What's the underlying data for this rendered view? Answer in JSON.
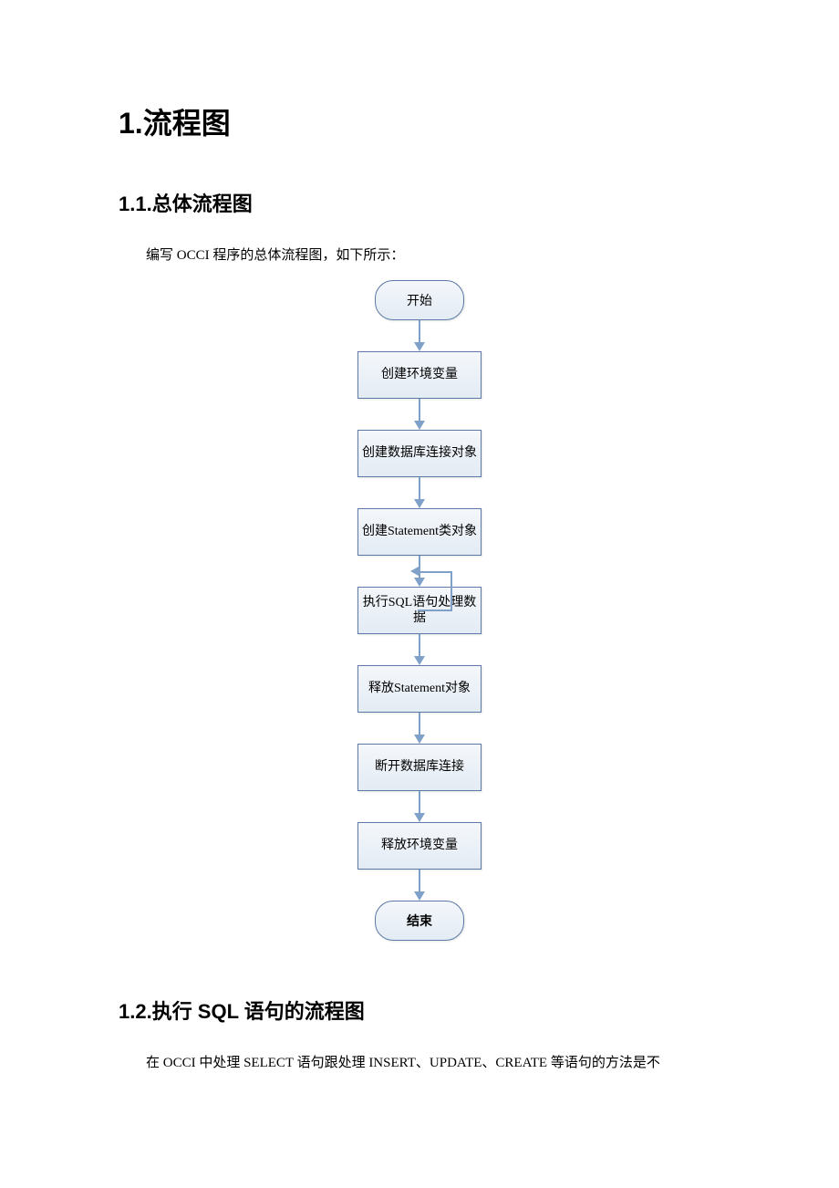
{
  "headings": {
    "h1": "1.流程图",
    "h1_1": "1.1.总体流程图",
    "h1_2": "1.2.执行 SQL 语句的流程图"
  },
  "paragraphs": {
    "intro1": "编写 OCCI 程序的总体流程图，如下所示：",
    "intro2": "在 OCCI 中处理 SELECT 语句跟处理 INSERT、UPDATE、CREATE 等语句的方法是不"
  },
  "flow": {
    "start": "开始",
    "n1": "创建环境变量",
    "n2": "创建数据库连接对象",
    "n3": "创建Statement类对象",
    "n4": "执行SQL语句处理数据",
    "n5": "释放Statement对象",
    "n6": "断开数据库连接",
    "n7": "释放环境变量",
    "end": "结束"
  },
  "chart_data": {
    "type": "flowchart",
    "title": "编写 OCCI 程序的总体流程图",
    "nodes": [
      {
        "id": "start",
        "shape": "terminator",
        "label": "开始"
      },
      {
        "id": "n1",
        "shape": "process",
        "label": "创建环境变量"
      },
      {
        "id": "n2",
        "shape": "process",
        "label": "创建数据库连接对象"
      },
      {
        "id": "n3",
        "shape": "process",
        "label": "创建Statement类对象"
      },
      {
        "id": "n4",
        "shape": "process",
        "label": "执行SQL语句处理数据"
      },
      {
        "id": "n5",
        "shape": "process",
        "label": "释放Statement对象"
      },
      {
        "id": "n6",
        "shape": "process",
        "label": "断开数据库连接"
      },
      {
        "id": "n7",
        "shape": "process",
        "label": "释放环境变量"
      },
      {
        "id": "end",
        "shape": "terminator",
        "label": "结束"
      }
    ],
    "edges": [
      {
        "from": "start",
        "to": "n1"
      },
      {
        "from": "n1",
        "to": "n2"
      },
      {
        "from": "n2",
        "to": "n3"
      },
      {
        "from": "n3",
        "to": "n4"
      },
      {
        "from": "n4",
        "to": "n5"
      },
      {
        "from": "n5",
        "to": "n6"
      },
      {
        "from": "n6",
        "to": "n7"
      },
      {
        "from": "n7",
        "to": "end"
      },
      {
        "from": "n4",
        "to": "n4",
        "type": "self-loop"
      }
    ]
  }
}
